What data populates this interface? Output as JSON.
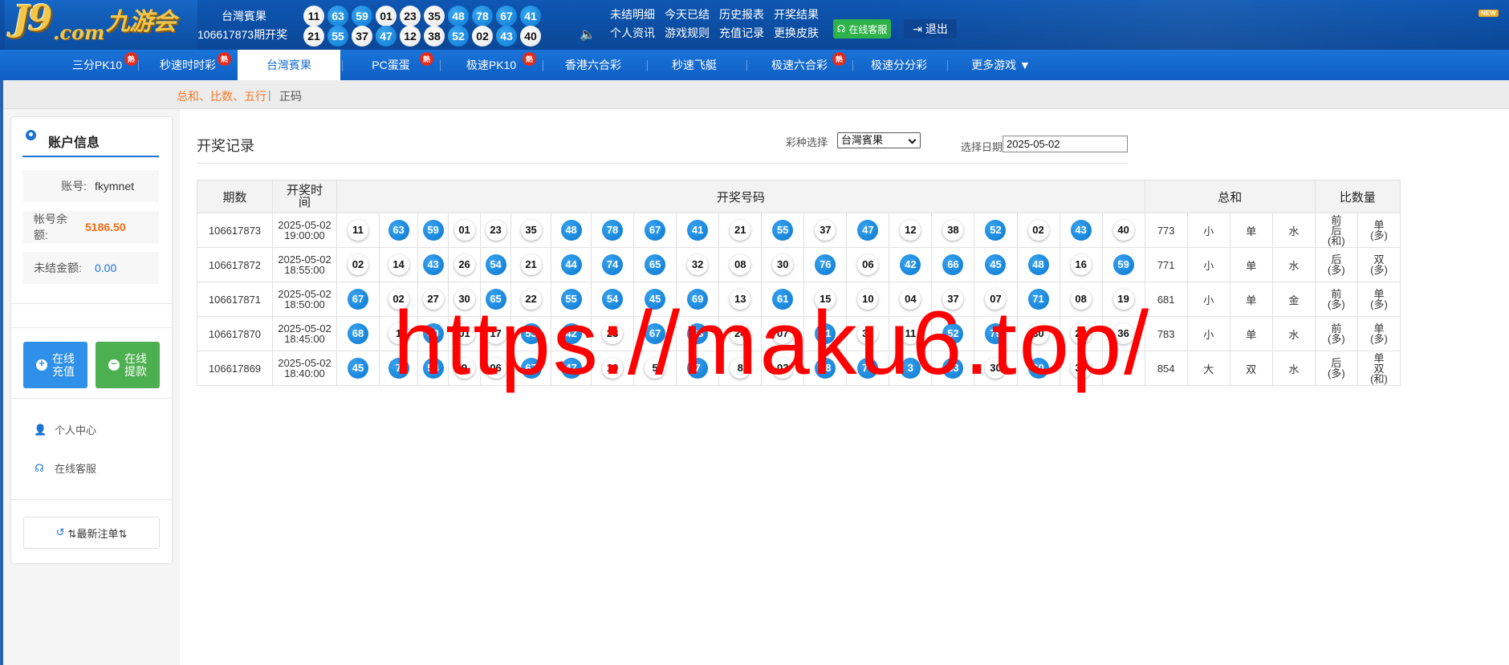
{
  "header": {
    "lottery_name": "台灣賓果",
    "issue_text": "106617873期开奖",
    "balls_row1": [
      {
        "n": "11",
        "c": "white"
      },
      {
        "n": "63",
        "c": "blue"
      },
      {
        "n": "59",
        "c": "blue"
      },
      {
        "n": "01",
        "c": "white"
      },
      {
        "n": "23",
        "c": "white"
      },
      {
        "n": "35",
        "c": "white"
      },
      {
        "n": "48",
        "c": "blue"
      },
      {
        "n": "78",
        "c": "blue"
      },
      {
        "n": "67",
        "c": "blue"
      },
      {
        "n": "41",
        "c": "blue"
      }
    ],
    "balls_row2": [
      {
        "n": "21",
        "c": "white"
      },
      {
        "n": "55",
        "c": "blue"
      },
      {
        "n": "37",
        "c": "white"
      },
      {
        "n": "47",
        "c": "blue"
      },
      {
        "n": "12",
        "c": "white"
      },
      {
        "n": "38",
        "c": "white"
      },
      {
        "n": "52",
        "c": "blue"
      },
      {
        "n": "02",
        "c": "white"
      },
      {
        "n": "43",
        "c": "blue"
      },
      {
        "n": "40",
        "c": "white"
      }
    ],
    "links": [
      "未结明细",
      "今天已结",
      "历史报表",
      "开奖结果",
      "个人资讯",
      "游戏规则",
      "充值记录",
      "更换皮肤"
    ],
    "customer_service": "在线客服",
    "logout": "退出",
    "new_badge": "NEW",
    "logo_text": "J9",
    "logo_com": ".com",
    "logo_cn": "九游会"
  },
  "nav": {
    "items": [
      {
        "label": "三分PK10",
        "hot": true
      },
      {
        "label": "秒速时时彩",
        "hot": true
      },
      {
        "label": "台灣賓果",
        "hot": false,
        "active": true
      },
      {
        "label": "PC蛋蛋",
        "hot": true
      },
      {
        "label": "极速PK10",
        "hot": true
      },
      {
        "label": "香港六合彩",
        "hot": false
      },
      {
        "label": "秒速飞艇",
        "hot": false
      },
      {
        "label": "极速六合彩",
        "hot": true
      },
      {
        "label": "极速分分彩",
        "hot": false
      },
      {
        "label": "更多游戏 ▼",
        "hot": false
      }
    ],
    "hot_label": "熱"
  },
  "subnav": {
    "link1": "总和、比数、五行",
    "sep": "|",
    "link2": "正码"
  },
  "sidebar": {
    "title": "账户信息",
    "account_label": "账号:",
    "account_value": "fkymnet",
    "balance_label": "帐号余额:",
    "balance_value": "5186.50",
    "unsettled_label": "未结金额:",
    "unsettled_value": "0.00",
    "recharge_label": "在线\n充值",
    "withdraw_label": "在线\n提款",
    "personal_center": "个人中心",
    "online_service": "在线客服",
    "latest_bets": "⇅最新注单⇅"
  },
  "main": {
    "title": "开奖记录",
    "lottery_select_label": "彩种选择",
    "lottery_select_value": "台灣賓果",
    "date_label": "选择日期",
    "date_value": "2025-05-02",
    "headers": {
      "issue": "期数",
      "time": "开奖时间",
      "numbers": "开奖号码",
      "sum": "总和",
      "compare": "比数量"
    }
  },
  "draws": [
    {
      "issue": "106617873",
      "date": "2025-05-02",
      "time": "19:00:00",
      "balls": [
        [
          "11",
          "w"
        ],
        [
          "63",
          "b"
        ],
        [
          "59",
          "b"
        ],
        [
          "01",
          "w"
        ],
        [
          "23",
          "w"
        ],
        [
          "35",
          "w"
        ],
        [
          "48",
          "b"
        ],
        [
          "78",
          "b"
        ],
        [
          "67",
          "b"
        ],
        [
          "41",
          "b"
        ],
        [
          "21",
          "w"
        ],
        [
          "55",
          "b"
        ],
        [
          "37",
          "w"
        ],
        [
          "47",
          "b"
        ],
        [
          "12",
          "w"
        ],
        [
          "38",
          "w"
        ],
        [
          "52",
          "b"
        ],
        [
          "02",
          "w"
        ],
        [
          "43",
          "b"
        ],
        [
          "40",
          "w"
        ]
      ],
      "sum": "773",
      "size": "小",
      "parity": "单",
      "element": "水",
      "front_back": {
        "lines": [
          "前",
          "后",
          "(和)"
        ],
        "color": "navy"
      },
      "odd_even": {
        "lines": [
          "单",
          "(多)"
        ],
        "color": "green"
      }
    },
    {
      "issue": "106617872",
      "date": "2025-05-02",
      "time": "18:55:00",
      "balls": [
        [
          "02",
          "w"
        ],
        [
          "14",
          "w"
        ],
        [
          "43",
          "b"
        ],
        [
          "26",
          "w"
        ],
        [
          "54",
          "b"
        ],
        [
          "21",
          "w"
        ],
        [
          "44",
          "b"
        ],
        [
          "74",
          "b"
        ],
        [
          "65",
          "b"
        ],
        [
          "32",
          "w"
        ],
        [
          "08",
          "w"
        ],
        [
          "30",
          "w"
        ],
        [
          "76",
          "b"
        ],
        [
          "06",
          "w"
        ],
        [
          "42",
          "b"
        ],
        [
          "66",
          "b"
        ],
        [
          "45",
          "b"
        ],
        [
          "48",
          "b"
        ],
        [
          "16",
          "w"
        ],
        [
          "59",
          "b"
        ]
      ],
      "sum": "771",
      "size": "小",
      "parity": "单",
      "element": "水",
      "front_back": {
        "lines": [
          "后",
          "(多)"
        ],
        "color": "dark"
      },
      "odd_even": {
        "lines": [
          "双",
          "(多)"
        ],
        "color": "red"
      }
    },
    {
      "issue": "106617871",
      "date": "2025-05-02",
      "time": "18:50:00",
      "balls": [
        [
          "67",
          "b"
        ],
        [
          "02",
          "w"
        ],
        [
          "27",
          "w"
        ],
        [
          "30",
          "w"
        ],
        [
          "65",
          "b"
        ],
        [
          "22",
          "w"
        ],
        [
          "55",
          "b"
        ],
        [
          "54",
          "b"
        ],
        [
          "45",
          "b"
        ],
        [
          "69",
          "b"
        ],
        [
          "13",
          "w"
        ],
        [
          "61",
          "b"
        ],
        [
          "15",
          "w"
        ],
        [
          "10",
          "w"
        ],
        [
          "04",
          "w"
        ],
        [
          "37",
          "w"
        ],
        [
          "07",
          "w"
        ],
        [
          "71",
          "b"
        ],
        [
          "08",
          "w"
        ],
        [
          "19",
          "w"
        ]
      ],
      "sum": "681",
      "size": "小",
      "parity": "单",
      "element": "金",
      "front_back": {
        "lines": [
          "前",
          "(多)"
        ],
        "color": "red"
      },
      "odd_even": {
        "lines": [
          "单",
          "(多)"
        ],
        "color": "green"
      }
    },
    {
      "issue": "106617870",
      "date": "2025-05-02",
      "time": "18:45:00",
      "balls": [
        [
          "68",
          "b"
        ],
        [
          "1",
          "w"
        ],
        [
          "80",
          "b"
        ],
        [
          "01",
          "w"
        ],
        [
          "17",
          "w"
        ],
        [
          "53",
          "b"
        ],
        [
          "42",
          "b"
        ],
        [
          "23",
          "w"
        ],
        [
          "67",
          "b"
        ],
        [
          "63",
          "b"
        ],
        [
          "24",
          "w"
        ],
        [
          "07",
          "w"
        ],
        [
          "61",
          "b"
        ],
        [
          "31",
          "w"
        ],
        [
          "11",
          "w"
        ],
        [
          "52",
          "b"
        ],
        [
          "79",
          "b"
        ],
        [
          "30",
          "w"
        ],
        [
          "28",
          "w"
        ],
        [
          "36",
          "w"
        ]
      ],
      "sum": "783",
      "size": "小",
      "parity": "单",
      "element": "水",
      "front_back": {
        "lines": [
          "前",
          "(多)"
        ],
        "color": "red"
      },
      "odd_even": {
        "lines": [
          "单",
          "(多)"
        ],
        "color": "green"
      }
    },
    {
      "issue": "106617869",
      "date": "2025-05-02",
      "time": "18:40:00",
      "balls": [
        [
          "45",
          "b"
        ],
        [
          "7",
          "b"
        ],
        [
          "54",
          "b"
        ],
        [
          "9",
          "w"
        ],
        [
          "06",
          "w"
        ],
        [
          "67",
          "b"
        ],
        [
          "47",
          "b"
        ],
        [
          "10",
          "w"
        ],
        [
          "5",
          "w"
        ],
        [
          "7",
          "b"
        ],
        [
          "8",
          "w"
        ],
        [
          "03",
          "w"
        ],
        [
          "48",
          "b"
        ],
        [
          "70",
          "b"
        ],
        [
          "3",
          "b"
        ],
        [
          "63",
          "b"
        ],
        [
          "30",
          "w"
        ],
        [
          "60",
          "b"
        ],
        [
          "39",
          "w"
        ]
      ],
      "sum": "854",
      "size": "大",
      "parity": "双",
      "element": "水",
      "size_color": "red",
      "parity_color": "red",
      "front_back": {
        "lines": [
          "后",
          "(多)"
        ],
        "color": "dark"
      },
      "odd_even": {
        "lines": [
          "单",
          "双",
          "(和)"
        ],
        "color": "navy"
      }
    }
  ],
  "watermark": "https://maku6.top/"
}
